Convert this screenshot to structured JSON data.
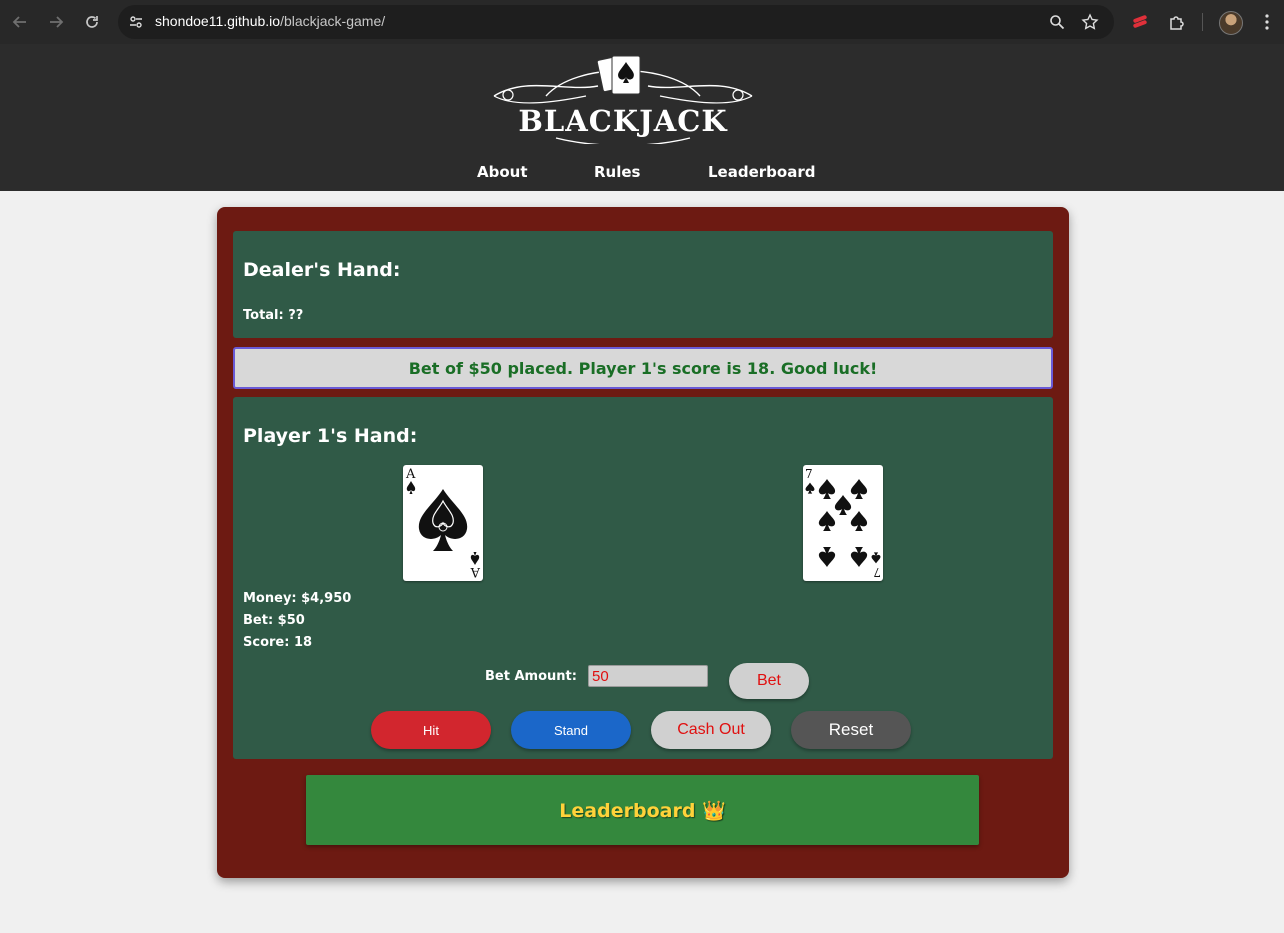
{
  "browser": {
    "url_host": "shondoe11.github.io",
    "url_path": "/blackjack-game/",
    "icons": [
      "back-arrow-icon",
      "forward-arrow-icon",
      "reload-icon",
      "site-info-icon",
      "zoom-icon",
      "bookmark-star-icon",
      "extension-icon",
      "puzzle-icon",
      "profile-avatar",
      "menu-kebab-icon"
    ]
  },
  "header": {
    "logo_text": "BLACKJACK",
    "nav": [
      "About",
      "Rules",
      "Leaderboard"
    ]
  },
  "dealer": {
    "title": "Dealer's Hand:",
    "total_label": "Total: ??"
  },
  "message": "Bet of $50 placed. Player 1's score is 18. Good luck!",
  "player": {
    "title": "Player 1's Hand:",
    "cards": [
      {
        "rank": "A",
        "suit": "spades"
      },
      {
        "rank": "7",
        "suit": "spades"
      }
    ],
    "money": "Money: $4,950",
    "bet": "Bet: $50",
    "score": "Score: 18"
  },
  "controls": {
    "bet_amount_label": "Bet Amount:",
    "bet_amount_value": "50",
    "bet_button": "Bet",
    "hit": "Hit",
    "stand": "Stand",
    "cash_out": "Cash Out",
    "reset": "Reset"
  },
  "leaderboard_button": "Leaderboard 👑",
  "colors": {
    "table": "#6d1a12",
    "felt": "#305a47",
    "message_text": "#1a6e26",
    "hit": "#d2262e",
    "stand": "#1b67c9",
    "reset": "#555555",
    "leaderboard": "#34883d",
    "leaderboard_text": "#ffd23a"
  }
}
